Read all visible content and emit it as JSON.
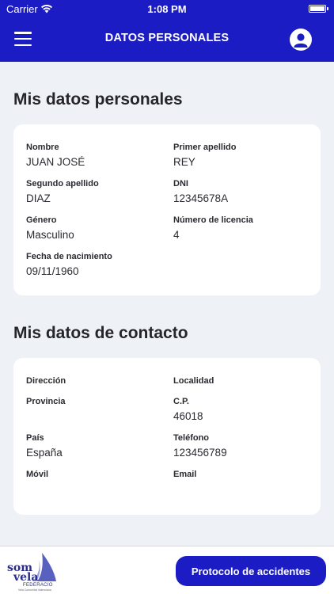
{
  "status_bar": {
    "carrier": "Carrier",
    "time": "1:08 PM"
  },
  "header": {
    "title": "DATOS PERSONALES"
  },
  "personal": {
    "title": "Mis datos personales",
    "fields": {
      "nombre": {
        "label": "Nombre",
        "value": "JUAN JOSÉ"
      },
      "primer_apellido": {
        "label": "Primer apellido",
        "value": "REY"
      },
      "segundo_apellido": {
        "label": "Segundo apellido",
        "value": "DIAZ"
      },
      "dni": {
        "label": "DNI",
        "value": "12345678A"
      },
      "genero": {
        "label": "Género",
        "value": "Masculino"
      },
      "licencia": {
        "label": "Número de licencia",
        "value": "4"
      },
      "nacimiento": {
        "label": "Fecha de nacimiento",
        "value": "09/11/1960"
      }
    }
  },
  "contact": {
    "title": "Mis datos de contacto",
    "fields": {
      "direccion": {
        "label": "Dirección",
        "value": ""
      },
      "localidad": {
        "label": "Localidad",
        "value": ""
      },
      "provincia": {
        "label": "Provincia",
        "value": ""
      },
      "cp": {
        "label": "C.P.",
        "value": "46018"
      },
      "pais": {
        "label": "País",
        "value": "España"
      },
      "telefono": {
        "label": "Teléfono",
        "value": "123456789"
      },
      "movil": {
        "label": "Móvil",
        "value": ""
      },
      "email": {
        "label": "Email",
        "value": ""
      }
    }
  },
  "footer": {
    "logo": {
      "line1": "som",
      "line2": "vela",
      "org": "FEDERACIO",
      "sub": "Vela Comunitat Valenciana"
    },
    "cta_label": "Protocolo de accidentes"
  },
  "colors": {
    "primary": "#1c1cc4",
    "background": "#eef2f7",
    "card": "#ffffff"
  },
  "icons": {
    "menu": "hamburger-menu-icon",
    "profile": "user-profile-icon",
    "wifi": "wifi-icon",
    "battery": "battery-icon"
  }
}
